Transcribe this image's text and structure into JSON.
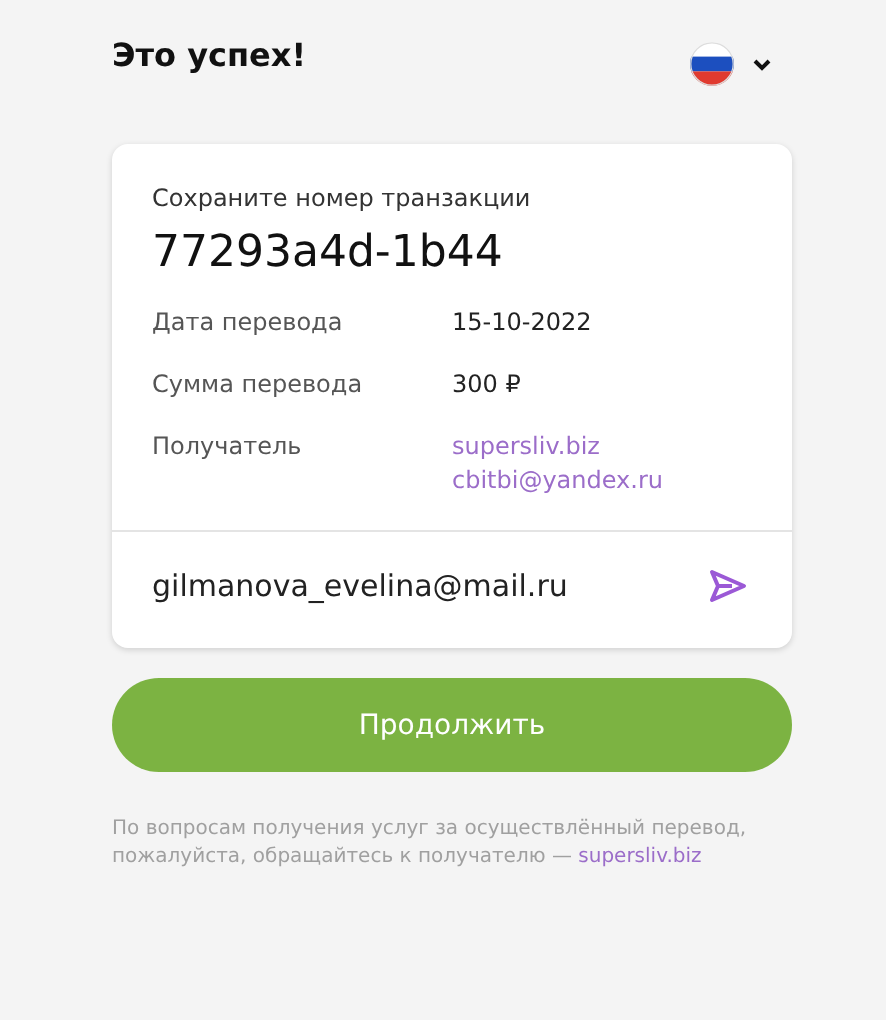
{
  "title": "Это успех!",
  "card": {
    "caption": "Сохраните номер транзакции",
    "transaction_id": "77293a4d-1b44",
    "details": [
      {
        "label": "Дата перевода",
        "kind": "text",
        "values": [
          "15-10-2022"
        ]
      },
      {
        "label": "Сумма перевода",
        "kind": "text",
        "values": [
          "300 ₽"
        ]
      },
      {
        "label": "Получатель",
        "kind": "link",
        "values": [
          "supersliv.biz",
          "cbitbi@yandex.ru"
        ]
      }
    ],
    "email": {
      "value": "gilmanova_evelina@mail.ru"
    }
  },
  "button": "Продолжить",
  "footer": {
    "text": "По вопросам получения услуг за осуществлённый перевод, пожалуйста, обращайтесь к получателю —",
    "link": "supersliv.biz"
  }
}
